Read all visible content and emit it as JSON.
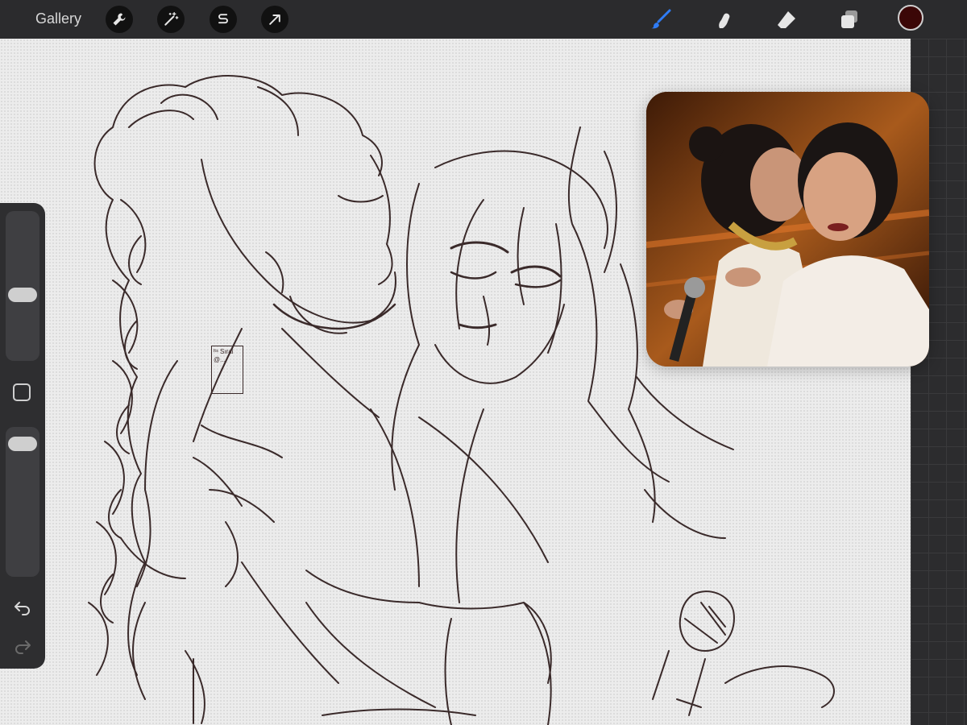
{
  "topbar": {
    "gallery_label": "Gallery",
    "left_tools": [
      "wrench-icon",
      "magic-wand-icon",
      "selection-icon",
      "transform-arrow-icon"
    ],
    "right_tools": [
      "brush-icon",
      "smudge-icon",
      "eraser-icon",
      "layers-icon"
    ],
    "active_tool": "brush-icon",
    "active_tool_color": "#2f7cf6",
    "current_color": "#3b0707"
  },
  "sidebar": {
    "brush_size_level": 0.43,
    "opacity_level": 0.95,
    "controls": [
      "modify-button",
      "undo-icon",
      "redo-icon"
    ]
  },
  "reference": {
    "kind": "photo reference",
    "background_color": "#9b4f1a"
  },
  "canvas": {
    "signature_text": "ᴵᵗˢ Sırai @..."
  }
}
